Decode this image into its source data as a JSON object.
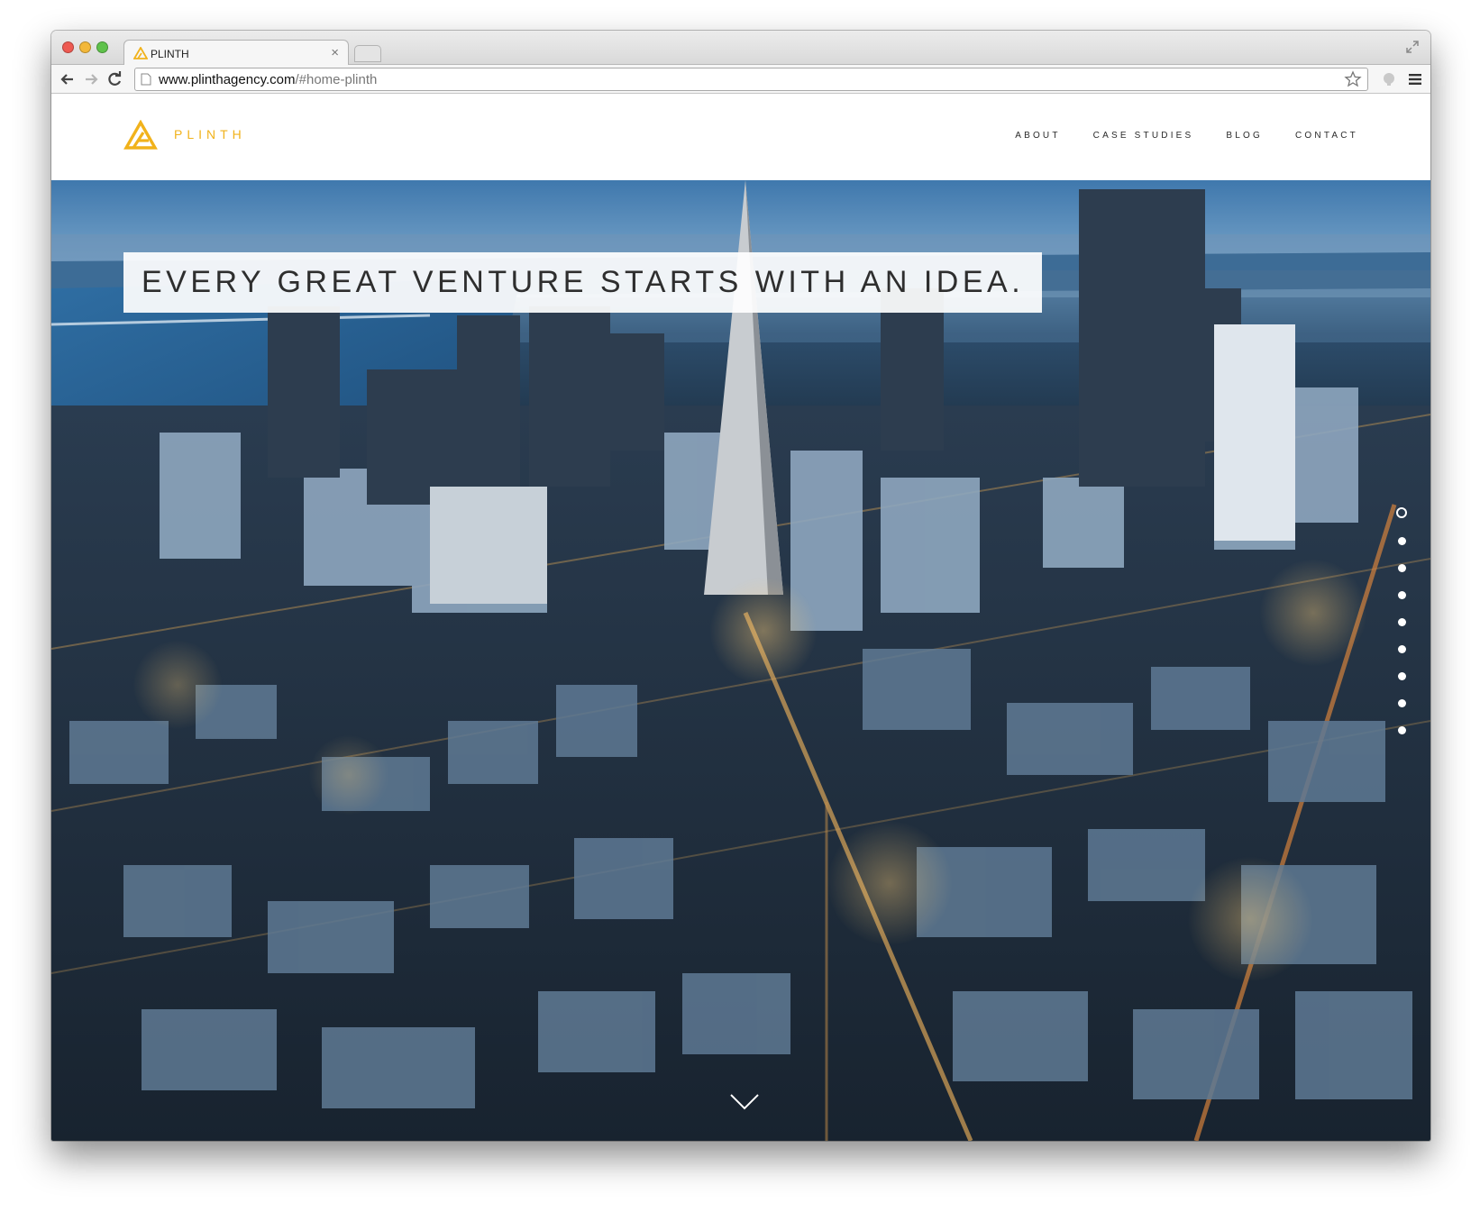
{
  "browser": {
    "tab_title": "PLINTH",
    "tab_close": "×",
    "url_host": "www.plinthagency.com",
    "url_path": "/#home-plinth"
  },
  "header": {
    "logo_text": "PLINTH",
    "brand_color": "#f1b21b",
    "nav": [
      {
        "label": "ABOUT"
      },
      {
        "label": "CASE STUDIES"
      },
      {
        "label": "BLOG"
      },
      {
        "label": "CONTACT"
      }
    ]
  },
  "hero": {
    "headline": "EVERY GREAT VENTURE STARTS WITH AN IDEA.",
    "slides_count": 9,
    "active_slide": 1
  }
}
